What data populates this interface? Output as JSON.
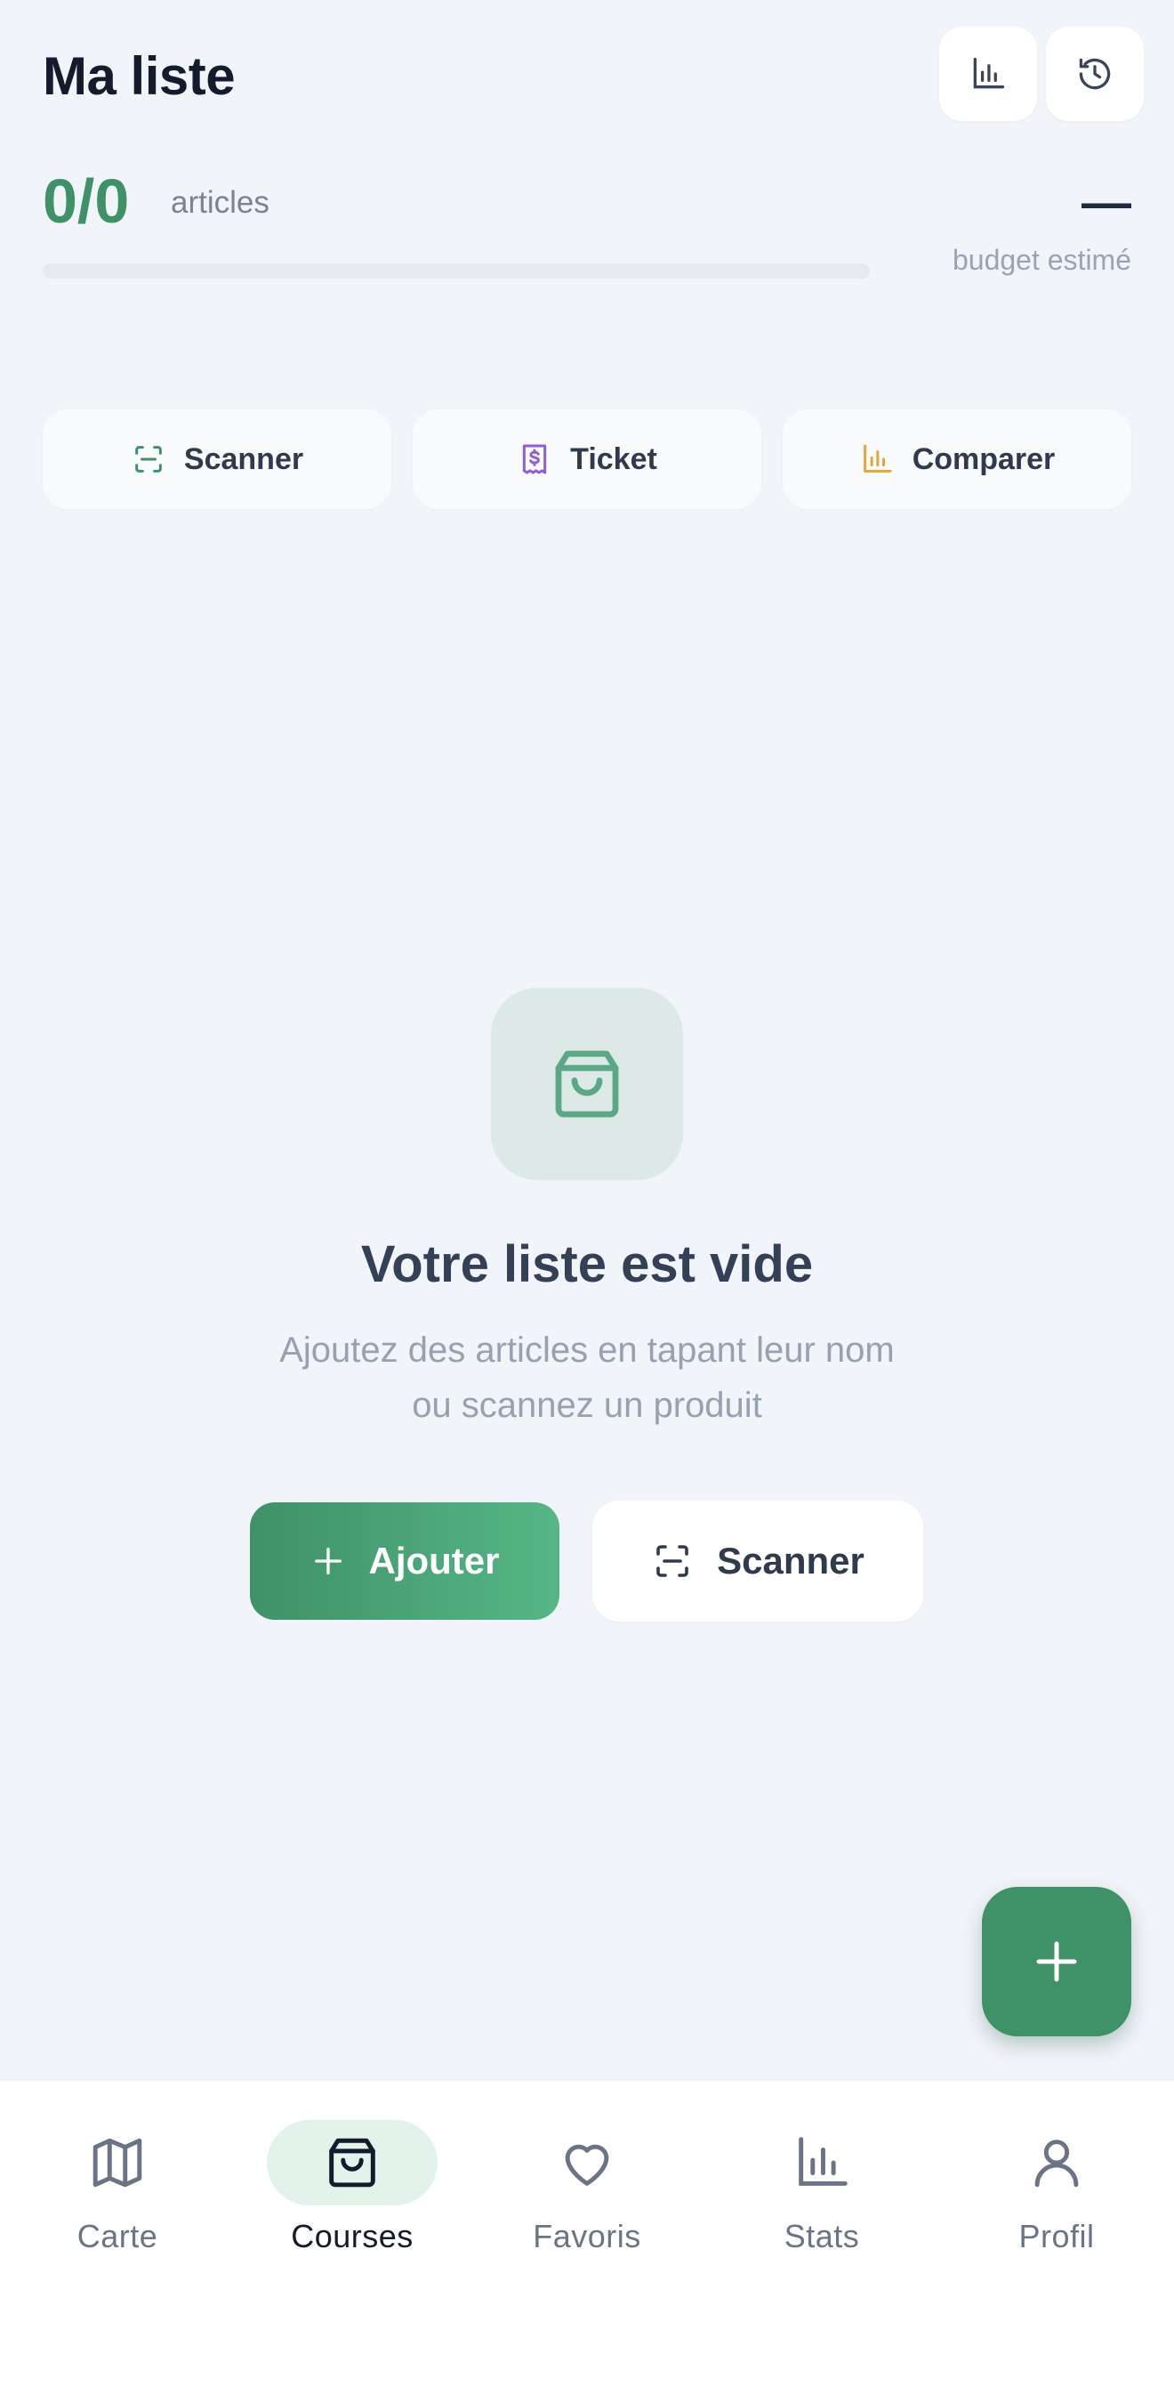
{
  "header": {
    "title": "Ma liste",
    "stats_icon": "bar-chart-icon",
    "history_icon": "history-icon"
  },
  "summary": {
    "count": "0/0",
    "count_label": "articles",
    "progress_percent": 0,
    "budget_value": "—",
    "budget_label": "budget estimé"
  },
  "quick_actions": [
    {
      "label": "Scanner",
      "icon": "scan-icon",
      "color": "#3f9168"
    },
    {
      "label": "Ticket",
      "icon": "receipt-icon",
      "color": "#8e5fd1"
    },
    {
      "label": "Comparer",
      "icon": "bar-chart-icon",
      "color": "#e0a83a"
    }
  ],
  "empty_state": {
    "icon": "shopping-bag-icon",
    "title": "Votre liste est vide",
    "subtitle_line1": "Ajoutez des articles en tapant leur nom",
    "subtitle_line2": "ou scannez un produit",
    "add_label": "Ajouter",
    "scan_label": "Scanner"
  },
  "fab": {
    "icon": "plus-icon"
  },
  "nav": {
    "items": [
      {
        "label": "Carte",
        "icon": "map-icon",
        "active": false
      },
      {
        "label": "Courses",
        "icon": "shopping-bag-icon",
        "active": true
      },
      {
        "label": "Favoris",
        "icon": "heart-icon",
        "active": false
      },
      {
        "label": "Stats",
        "icon": "bar-chart-icon",
        "active": false
      },
      {
        "label": "Profil",
        "icon": "user-icon",
        "active": false
      }
    ]
  },
  "colors": {
    "accent": "#3f9168",
    "accent_light": "#56b686",
    "background": "#f1f4f9",
    "text_dark": "#141b2d",
    "text_muted": "#98a1b0"
  }
}
